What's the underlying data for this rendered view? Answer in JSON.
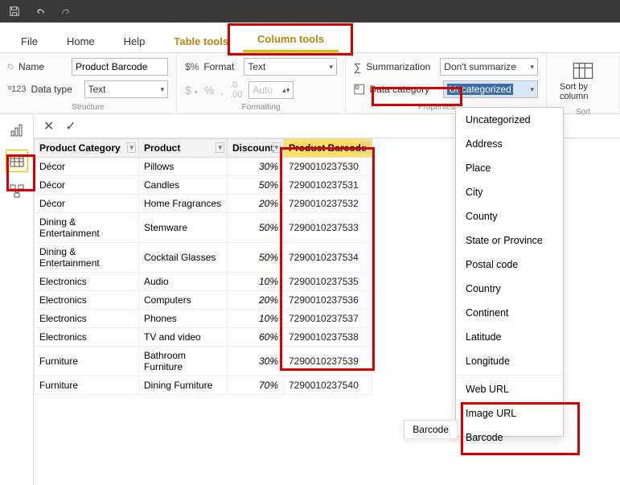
{
  "tabs": {
    "file": "File",
    "home": "Home",
    "help": "Help",
    "table_tools": "Table tools",
    "column_tools": "Column tools"
  },
  "structure": {
    "name_label": "Name",
    "name_value": "Product Barcode",
    "datatype_label": "Data type",
    "datatype_value": "Text",
    "group_label": "Structure"
  },
  "formatting": {
    "format_label": "Format",
    "format_value": "Text",
    "auto_placeholder": "Auto",
    "group_label": "Formatting"
  },
  "properties": {
    "summarization_label": "Summarization",
    "summarization_value": "Don't summarize",
    "datacategory_label": "Data category",
    "datacategory_value": "Uncategorized",
    "group_label": "Properties"
  },
  "sort": {
    "label": "Sort by column",
    "group_label": "Sort"
  },
  "columns": {
    "category": "Product Category",
    "product": "Product",
    "discount": "Discount",
    "barcode": "Product Barcode"
  },
  "rows": [
    {
      "category": "Décor",
      "product": "Pillows",
      "discount": "30%",
      "barcode": "7290010237530"
    },
    {
      "category": "Décor",
      "product": "Candles",
      "discount": "50%",
      "barcode": "7290010237531"
    },
    {
      "category": "Décor",
      "product": "Home Fragrances",
      "discount": "20%",
      "barcode": "7290010237532"
    },
    {
      "category": "Dining & Entertainment",
      "product": "Stemware",
      "discount": "50%",
      "barcode": "7290010237533"
    },
    {
      "category": "Dining & Entertainment",
      "product": "Cocktail Glasses",
      "discount": "50%",
      "barcode": "7290010237534"
    },
    {
      "category": "Electronics",
      "product": "Audio",
      "discount": "10%",
      "barcode": "7290010237535"
    },
    {
      "category": "Electronics",
      "product": "Computers",
      "discount": "20%",
      "barcode": "7290010237536"
    },
    {
      "category": "Electronics",
      "product": "Phones",
      "discount": "10%",
      "barcode": "7290010237537"
    },
    {
      "category": "Electronics",
      "product": "TV and video",
      "discount": "60%",
      "barcode": "7290010237538"
    },
    {
      "category": "Furniture",
      "product": "Bathroom Furniture",
      "discount": "30%",
      "barcode": "7290010237539"
    },
    {
      "category": "Furniture",
      "product": "Dining Furniture",
      "discount": "70%",
      "barcode": "7290010237540"
    }
  ],
  "category_menu": {
    "items": [
      "Uncategorized",
      "Address",
      "Place",
      "City",
      "County",
      "State or Province",
      "Postal code",
      "Country",
      "Continent",
      "Latitude",
      "Longitude"
    ],
    "items2": [
      "Web URL",
      "Image URL",
      "Barcode"
    ]
  },
  "tooltip": "Barcode"
}
